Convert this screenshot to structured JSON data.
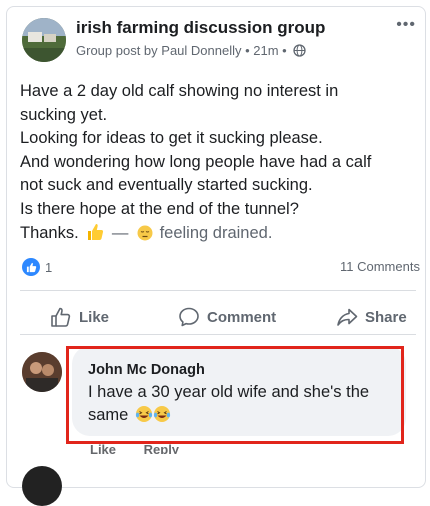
{
  "post": {
    "group_name": "irish farming discussion group",
    "subline": "Group post by Paul Donnelly • 21m •",
    "more_label": "•••",
    "lines": [
      "Have a 2 day old calf showing no interest in",
      "sucking yet.",
      "Looking for ideas to get it sucking please.",
      "And wondering how long people have had a calf",
      "not suck and eventually started sucking.",
      "Is there hope at the end of the tunnel?"
    ],
    "thanks": "Thanks.",
    "dash": "—",
    "feeling": "feeling drained."
  },
  "reactions": {
    "like_count": "1",
    "comments_count": "11 Comments"
  },
  "actions": {
    "like": "Like",
    "comment": "Comment",
    "share": "Share"
  },
  "comment": {
    "author": "John Mc Donagh",
    "line1": "I have a 30 year old wife and she's the",
    "line2": "same",
    "like": "Like",
    "reply": "Reply"
  },
  "colors": {
    "highlight": "#e1251b",
    "like_blue": "#2d88ff"
  }
}
